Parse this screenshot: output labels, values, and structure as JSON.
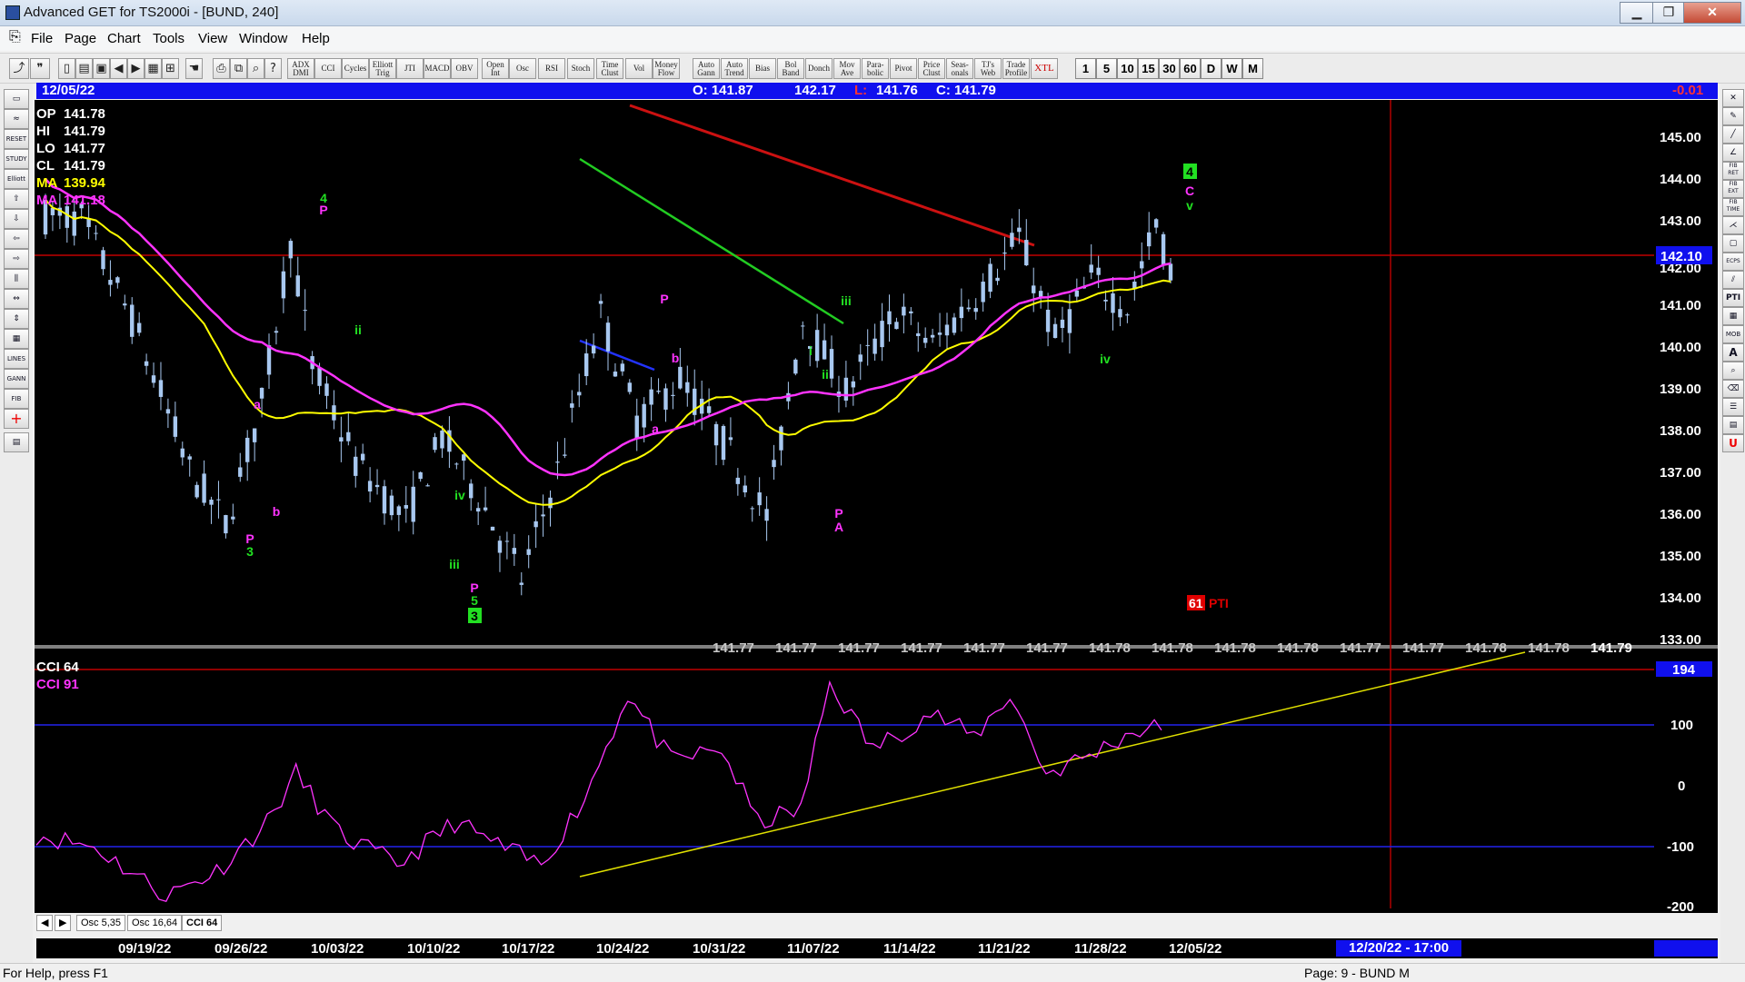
{
  "window": {
    "title": "Advanced GET for TS2000i - [BUND, 240]"
  },
  "menu": [
    "File",
    "Page",
    "Chart",
    "Tools",
    "View",
    "Window",
    "Help"
  ],
  "toolbar": {
    "studies": [
      "ADX DMI",
      "CCI",
      "Cycles",
      "Elliott Trig",
      "JTI",
      "MACD",
      "OBV",
      "Open Int",
      "Osc",
      "RSI",
      "Stoch",
      "Time Clust",
      "Vol",
      "Money Flow",
      "Auto Gann",
      "Auto Trend",
      "Bias",
      "Bol Band",
      "Donch",
      "Mov Ave",
      "Para-bolic",
      "Pivot",
      "Price Clust",
      "Seas-onals",
      "TJ's Web",
      "Trade Profile",
      "XTL"
    ],
    "timeframes": [
      "1",
      "5",
      "10",
      "15",
      "30",
      "60",
      "D",
      "W",
      "M"
    ]
  },
  "lefttools": [
    "RESET",
    "STUDY",
    "Elliott",
    "LINES",
    "GANN",
    "FIB"
  ],
  "righttools": [
    "FIB RET",
    "FIB EXT",
    "FIB TIME",
    "ECPS",
    "PTI",
    "MOB",
    "A",
    "U"
  ],
  "header": {
    "date": "12/05/22",
    "open": "O: 141.87",
    "high": "142.17",
    "low_prefix": "L:",
    "low": "141.76",
    "close": "C: 141.79",
    "change": "-0.01"
  },
  "legend": {
    "op_label": "OP",
    "op": "141.78",
    "hi_label": "HI",
    "hi": "141.79",
    "lo_label": "LO",
    "lo": "141.77",
    "cl_label": "CL",
    "cl": "141.79",
    "ma1_label": "MA",
    "ma1": "139.94",
    "ma2_label": "MA",
    "ma2": "141.18"
  },
  "colors": {
    "bg": "#000000",
    "candle": "#a8c8f0",
    "ma_fast": "#ffff00",
    "ma_slow": "#ff33ff",
    "green": "#22e022",
    "magenta": "#ff33ff",
    "red": "#e00000",
    "header": "#1010ee"
  },
  "price_axis": {
    "ticks": [
      "145.00",
      "144.00",
      "143.00",
      "142.00",
      "141.00",
      "140.00",
      "139.00",
      "138.00",
      "137.00",
      "136.00",
      "135.00",
      "134.00",
      "133.00"
    ],
    "current": "142.10"
  },
  "bottom_values": [
    "141.77",
    "141.77",
    "141.77",
    "141.77",
    "141.77",
    "141.77",
    "141.78",
    "141.78",
    "141.78",
    "141.78",
    "141.77",
    "141.77",
    "141.78",
    "141.78",
    "141.79"
  ],
  "cci": {
    "label1": "CCI 64",
    "label2": "CCI  91",
    "ticks": [
      "100",
      "0",
      "-100",
      "-200"
    ],
    "current": "194"
  },
  "osc_tabs": [
    "Osc 5,35",
    "Osc 16,64",
    "CCI 64"
  ],
  "dates": [
    "09/19/22",
    "09/26/22",
    "10/03/22",
    "10/10/22",
    "10/17/22",
    "10/24/22",
    "10/31/22",
    "11/07/22",
    "11/14/22",
    "11/21/22",
    "11/28/22",
    "12/05/22"
  ],
  "cursor_date": "12/20/22 - 17:00",
  "elliott_labels": {
    "w3": "3",
    "w4": "4",
    "w5": "5",
    "box3": "3",
    "box4": "4",
    "p": "P",
    "a": "a",
    "b": "b",
    "c": "c",
    "i": "i",
    "ii": "ii",
    "iii": "iii",
    "iv": "iv",
    "v": "v",
    "A": "A",
    "B": "B",
    "C": "C"
  },
  "pti": {
    "value": "61",
    "label": "PTI"
  },
  "status": {
    "help": "For Help, press F1",
    "page": "Page: 9 - BUND M"
  }
}
